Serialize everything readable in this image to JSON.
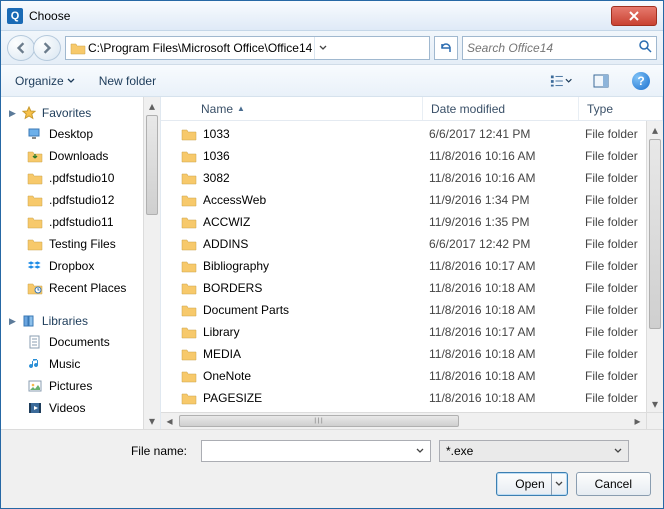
{
  "window": {
    "title": "Choose"
  },
  "nav": {
    "path": "C:\\Program Files\\Microsoft Office\\Office14"
  },
  "search": {
    "placeholder": "Search Office14"
  },
  "toolbar": {
    "organize": "Organize",
    "newfolder": "New folder"
  },
  "sidebar": {
    "favorites_label": "Favorites",
    "favorites": [
      {
        "label": "Desktop",
        "icon": "desktop"
      },
      {
        "label": "Downloads",
        "icon": "downloads"
      },
      {
        "label": ".pdfstudio10",
        "icon": "folder"
      },
      {
        "label": ".pdfstudio12",
        "icon": "folder"
      },
      {
        "label": ".pdfstudio11",
        "icon": "folder"
      },
      {
        "label": "Testing Files",
        "icon": "folder"
      },
      {
        "label": "Dropbox",
        "icon": "dropbox"
      },
      {
        "label": "Recent Places",
        "icon": "recent"
      }
    ],
    "libraries_label": "Libraries",
    "libraries": [
      {
        "label": "Documents",
        "icon": "documents"
      },
      {
        "label": "Music",
        "icon": "music"
      },
      {
        "label": "Pictures",
        "icon": "pictures"
      },
      {
        "label": "Videos",
        "icon": "videos"
      }
    ]
  },
  "columns": {
    "name": "Name",
    "date": "Date modified",
    "type": "Type"
  },
  "files": [
    {
      "name": "1033",
      "date": "6/6/2017 12:41 PM",
      "type": "File folder"
    },
    {
      "name": "1036",
      "date": "11/8/2016 10:16 AM",
      "type": "File folder"
    },
    {
      "name": "3082",
      "date": "11/8/2016 10:16 AM",
      "type": "File folder"
    },
    {
      "name": "AccessWeb",
      "date": "11/9/2016 1:34 PM",
      "type": "File folder"
    },
    {
      "name": "ACCWIZ",
      "date": "11/9/2016 1:35 PM",
      "type": "File folder"
    },
    {
      "name": "ADDINS",
      "date": "6/6/2017 12:42 PM",
      "type": "File folder"
    },
    {
      "name": "Bibliography",
      "date": "11/8/2016 10:17 AM",
      "type": "File folder"
    },
    {
      "name": "BORDERS",
      "date": "11/8/2016 10:18 AM",
      "type": "File folder"
    },
    {
      "name": "Document Parts",
      "date": "11/8/2016 10:18 AM",
      "type": "File folder"
    },
    {
      "name": "Library",
      "date": "11/8/2016 10:17 AM",
      "type": "File folder"
    },
    {
      "name": "MEDIA",
      "date": "11/8/2016 10:18 AM",
      "type": "File folder"
    },
    {
      "name": "OneNote",
      "date": "11/8/2016 10:18 AM",
      "type": "File folder"
    },
    {
      "name": "PAGESIZE",
      "date": "11/8/2016 10:18 AM",
      "type": "File folder"
    }
  ],
  "footer": {
    "filename_label": "File name:",
    "filename_value": "",
    "filter": "*.exe",
    "open": "Open",
    "cancel": "Cancel"
  }
}
